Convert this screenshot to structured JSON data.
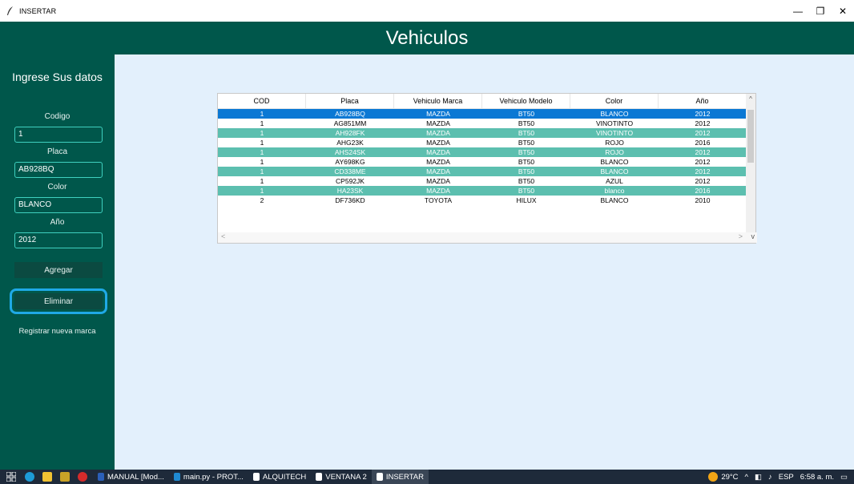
{
  "window": {
    "title": "INSERTAR",
    "minimize_glyph": "—",
    "maximize_glyph": "❐",
    "close_glyph": "✕"
  },
  "header": {
    "title": "Vehiculos"
  },
  "sidebar": {
    "heading": "Ingrese Sus datos",
    "fields": [
      {
        "label": "Codigo",
        "value": "1"
      },
      {
        "label": "Placa",
        "value": "AB928BQ"
      },
      {
        "label": "Color",
        "value": "BLANCO"
      },
      {
        "label": "Año",
        "value": "2012"
      }
    ],
    "add_label": "Agregar",
    "delete_label": "Eliminar",
    "register_brand_label": "Registrar nueva marca"
  },
  "table": {
    "columns": [
      "COD",
      "Placa",
      "Vehiculo Marca",
      "Vehiculo Modelo",
      "Color",
      "Año"
    ],
    "rows": [
      {
        "style": "selected",
        "cells": [
          "1",
          "AB928BQ",
          "MAZDA",
          "BT50",
          "BLANCO",
          "2012"
        ]
      },
      {
        "style": "white",
        "cells": [
          "1",
          "AG851MM",
          "MAZDA",
          "BT50",
          "VINOTINTO",
          "2012"
        ]
      },
      {
        "style": "teal",
        "cells": [
          "1",
          "AH928FK",
          "MAZDA",
          "BT50",
          "VINOTINTO",
          "2012"
        ]
      },
      {
        "style": "white",
        "cells": [
          "1",
          "AHG23K",
          "MAZDA",
          "BT50",
          "ROJO",
          "2016"
        ]
      },
      {
        "style": "teal",
        "cells": [
          "1",
          "AHS24SK",
          "MAZDA",
          "BT50",
          "ROJO",
          "2012"
        ]
      },
      {
        "style": "white",
        "cells": [
          "1",
          "AY698KG",
          "MAZDA",
          "BT50",
          "BLANCO",
          "2012"
        ]
      },
      {
        "style": "teal",
        "cells": [
          "1",
          "CD338ME",
          "MAZDA",
          "BT50",
          "BLANCO",
          "2012"
        ]
      },
      {
        "style": "white",
        "cells": [
          "1",
          "CP592JK",
          "MAZDA",
          "BT50",
          "AZUL",
          "2012"
        ]
      },
      {
        "style": "teal",
        "cells": [
          "1",
          "HA23SK",
          "MAZDA",
          "BT50",
          "blanco",
          "2016"
        ]
      },
      {
        "style": "white",
        "cells": [
          "2",
          "DF736KD",
          "TOYOTA",
          "HILUX",
          "BLANCO",
          "2010"
        ]
      }
    ]
  },
  "taskbar": {
    "items": [
      {
        "label": "MANUAL [Mod...",
        "active": false,
        "icon": "word-icon",
        "color": "#2b5fb8"
      },
      {
        "label": "main.py - PROT...",
        "active": false,
        "icon": "vscode-icon",
        "color": "#1f8ad2"
      },
      {
        "label": "ALQUITECH",
        "active": false,
        "icon": "feather-icon",
        "color": "#ffffff"
      },
      {
        "label": "VENTANA 2",
        "active": false,
        "icon": "feather-icon",
        "color": "#ffffff"
      },
      {
        "label": "INSERTAR",
        "active": true,
        "icon": "feather-icon",
        "color": "#ffffff"
      }
    ],
    "temperature": "29°C",
    "language": "ESP",
    "time": "6:58 a. m."
  },
  "colors": {
    "header_bg": "#00574b",
    "main_bg": "#e3f0fc",
    "teal_row": "#5cbfaf",
    "selected_row": "#0b78d4",
    "focus_ring": "#1fa9e6"
  }
}
